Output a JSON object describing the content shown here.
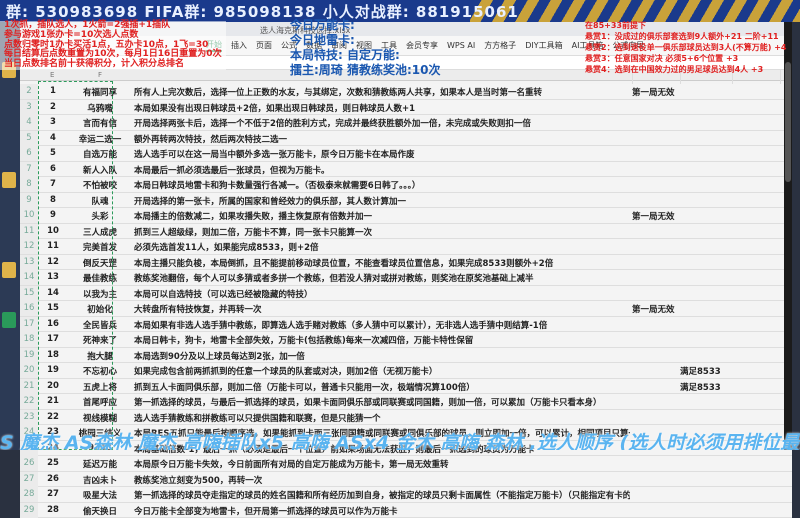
{
  "banner": {
    "text": "群: 530983698   FIFA群: 985098138   小人对战群: 881915061"
  },
  "window": {
    "tab_title": "选人海克斯科技选择.xlsx",
    "ribbon": [
      "开始",
      "插入",
      "页面",
      "公式",
      "数据",
      "审阅",
      "视图",
      "工具",
      "会员专享",
      "WPS AI",
      "方方格子",
      "DIY工具箱",
      "AI工具箱",
      "公式向导"
    ]
  },
  "columns": [
    "E",
    "F"
  ],
  "overlay_left": [
    "1次抓，插队选人，1火箭=2强插+1插队",
    "参与游戏1张办卡=10次选人点数",
    "点数归零时1办卡买活1点，五办卡10点，1飞=30",
    "每日结算后点数重置为10次，每月1日16日重置为0次",
    "当日点数排名前十获得积分，计入积分总排名"
  ],
  "overlay_center": [
    "今日万能卡:",
    "今日地雷卡:",
    "本局特技: 自定万能:",
    "擂主:周琦    猜教练奖池:10次"
  ],
  "overlay_right": [
    "在85+33前提下",
    "悬赏1：没成过的俱乐部套选到9人额外+21 二阶+11",
    "悬赏2：选到退役单一俱乐部球员达到3人(不算万能)  +4",
    "悬赏3：任意国家对决 必须5+6个位置 +3",
    "悬赏4：选到在中国效力过的男足球员达到4人 +3"
  ],
  "rows": [
    {
      "n": "1",
      "name": "有福同享",
      "desc": "所有人上完次数后，选择一位上正数的水友，与其绑定，次数和猜教练两人共享，如果本人是当时第一名重转",
      "note1": "第一局无效",
      "note2": ""
    },
    {
      "n": "2",
      "name": "乌鸦嘴",
      "desc": "本局如果没有出现日韩球员+2倍，如果出现日韩球员，则日韩球员人数+1",
      "note1": "",
      "note2": ""
    },
    {
      "n": "3",
      "name": "言而有信",
      "desc": "开局选择两张卡后，选择一个不低于2倍的胜利方式，完成并最终获胜额外加一倍，未完成或失败则扣一倍",
      "note1": "",
      "note2": ""
    },
    {
      "n": "4",
      "name": "幸运二选一",
      "desc": "额外再转两次特技，然后两次特技二选一",
      "note1": "",
      "note2": ""
    },
    {
      "n": "5",
      "name": "自选万能",
      "desc": "选人选手可以在这一局当中额外多选一张万能卡，原今日万能卡在本局作废",
      "note1": "",
      "note2": ""
    },
    {
      "n": "6",
      "name": "新人入队",
      "desc": "本局最后一抓必须选最后一张球员，但视为万能卡。",
      "note1": "",
      "note2": ""
    },
    {
      "n": "7",
      "name": "不怕被咬",
      "desc": "本局日韩球员地雷卡和狗卡数量强行各减一。（否极泰来就需要6日韩了。。。）",
      "note1": "",
      "note2": ""
    },
    {
      "n": "8",
      "name": "队魂",
      "desc": "开局选择的第一张卡，所属的国家和曾经效力的俱乐部，其人数计算加一",
      "note1": "",
      "note2": ""
    },
    {
      "n": "9",
      "name": "头彩",
      "desc": "本局播主的倍数减二，如果攻播失败，播主恢复原有倍数并加一",
      "note1": "第一局无效",
      "note2": ""
    },
    {
      "n": "10",
      "name": "三人成虎",
      "desc": "抓到三人超级绿，则加二倍，万能卡不算，同一张卡只能算一次",
      "note1": "",
      "note2": ""
    },
    {
      "n": "11",
      "name": "完美首发",
      "desc": "必须先选首发11人，如果能完成8533，则+2倍",
      "note1": "",
      "note2": ""
    },
    {
      "n": "12",
      "name": "倒反天罡",
      "desc": "本局主播只能负梭，本局倒抓，且不能提前移动球员位置，不能查看球员位置信息，如果完成8533则额外+2倍",
      "note1": "",
      "note2": ""
    },
    {
      "n": "13",
      "name": "最佳教练",
      "desc": "教练奖池翻倍，每个人可以多猜或者多拼一个教练，但若没人猜对或拼对教练，则奖池在原奖池基础上减半",
      "note1": "",
      "note2": ""
    },
    {
      "n": "14",
      "name": "以我为主",
      "desc": "本局可以自选特技（可以选已经被隐藏的特技）",
      "note1": "",
      "note2": ""
    },
    {
      "n": "15",
      "name": "初始化",
      "desc": "大转盘所有特技恢复，并再转一次",
      "note1": "第一局无效",
      "note2": ""
    },
    {
      "n": "16",
      "name": "全民皆兵",
      "desc": "本局如果有非选人选手猜中教练，即算选人选手赌对教练（多人猜中可以累计），无非选人选手猜中则结算-1倍",
      "note1": "",
      "note2": ""
    },
    {
      "n": "17",
      "name": "死神来了",
      "desc": "本局日韩卡，狗卡，地雷卡全部失效，万能卡(包括教练)每来一次减四倍，万能卡特性保留",
      "note1": "",
      "note2": ""
    },
    {
      "n": "18",
      "name": "抱大腿",
      "desc": "本局选到90分及以上球员每达到2张，加一倍",
      "note1": "",
      "note2": ""
    },
    {
      "n": "19",
      "name": "不忘初心",
      "desc": "如果完成包含前两抓抓到的任意一个球员的队套或对决，则加2倍（无视万能卡）",
      "note1": "",
      "note2": "满足8533"
    },
    {
      "n": "20",
      "name": "五虎上将",
      "desc": "抓到五人卡面同俱乐部，则加二倍（万能卡可以，普通卡只能用一次，极端情况算100倍）",
      "note1": "",
      "note2": "满足8533"
    },
    {
      "n": "21",
      "name": "首尾呼应",
      "desc": "第一抓选择的球员，与最后一抓选择的球员，如果卡面同俱乐部或同联赛或同国籍，则加一倍，可以累加（万能卡只看本身）",
      "note1": "",
      "note2": ""
    },
    {
      "n": "22",
      "name": "视线模糊",
      "desc": "选人选手猜教练和拼教练可以只提供国籍和联赛，但是只能猜一个",
      "note1": "",
      "note2": ""
    },
    {
      "n": "23",
      "name": "桃园三结义",
      "desc": "本局RES五抓只能最后按顺序选，如果能抓到卡面三张同国籍或同联赛或同俱乐部的球员，则立即加一倍，可以累计，相同项目只算一次",
      "note1": "",
      "note2": ""
    },
    {
      "n": "24",
      "name": "9248",
      "desc": "本局基础倍数-1，最后一抓（必须是最后一个位置）前如果场面无法获胜，则最后一抓选到的球员为万能卡",
      "note1": "",
      "note2": ""
    },
    {
      "n": "25",
      "name": "延迟万能",
      "desc": "本局原今日万能卡失效，今日前面所有对局的自定万能成为万能卡，第一局无效重转",
      "note1": "",
      "note2": ""
    },
    {
      "n": "26",
      "name": "吉凶未卜",
      "desc": "教练奖池立刻变为500，再转一次",
      "note1": "",
      "note2": ""
    },
    {
      "n": "27",
      "name": "吸星大法",
      "desc": "第一抓选择的球员夺走指定的球员的姓名国籍和所有经历加到自身，被指定的球员只剩卡面属性（不能指定万能卡）（只能指定有卡的球员）",
      "note1": "",
      "note2": ""
    },
    {
      "n": "28",
      "name": "偷天换日",
      "desc": "今日万能卡全部变为地雷卡，但开局第一抓选择的球员可以作为万能卡",
      "note1": "",
      "note2": ""
    }
  ],
  "marquee": "S 魔杰 AS森林 魔杰 高嗨插队x5 高嗨 ASx4 金木 高嗨 森林 ,选人顺序 (选人时必须用排位最靠"
}
